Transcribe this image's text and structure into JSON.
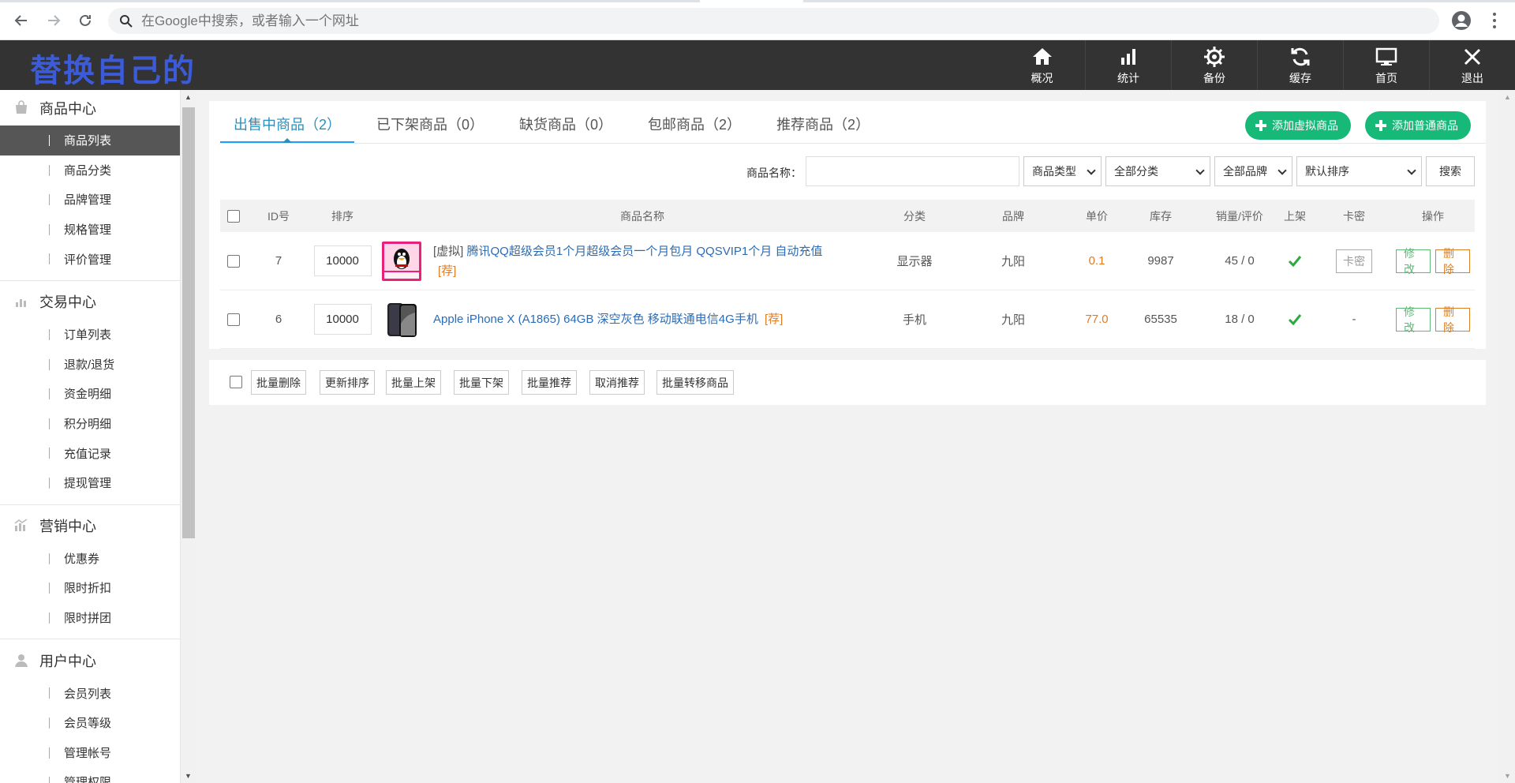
{
  "browser": {
    "omnibox_placeholder": "在Google中搜索，或者输入一个网址"
  },
  "header": {
    "logo_text": "替换自己的",
    "nav": [
      {
        "label": "概况",
        "icon": "home-icon"
      },
      {
        "label": "统计",
        "icon": "bar-chart-icon"
      },
      {
        "label": "备份",
        "icon": "gear-icon"
      },
      {
        "label": "缓存",
        "icon": "refresh-icon"
      },
      {
        "label": "首页",
        "icon": "monitor-icon"
      },
      {
        "label": "退出",
        "icon": "close-icon"
      }
    ]
  },
  "sidebar": {
    "groups": [
      {
        "title": "商品中心",
        "icon": "shop-icon",
        "items": [
          "商品列表",
          "商品分类",
          "品牌管理",
          "规格管理",
          "评价管理"
        ]
      },
      {
        "title": "交易中心",
        "icon": "bar-chart-icon",
        "items": [
          "订单列表",
          "退款/退货",
          "资金明细",
          "积分明细",
          "充值记录",
          "提现管理"
        ]
      },
      {
        "title": "营销中心",
        "icon": "marketing-icon",
        "items": [
          "优惠券",
          "限时折扣",
          "限时拼团"
        ]
      },
      {
        "title": "用户中心",
        "icon": "user-icon",
        "items": [
          "会员列表",
          "会员等级",
          "管理帐号",
          "管理权限"
        ]
      }
    ],
    "active_item": "商品列表"
  },
  "tabs": [
    {
      "label": "出售中商品（2）",
      "active": true
    },
    {
      "label": "已下架商品（0）",
      "active": false
    },
    {
      "label": "缺货商品（0）",
      "active": false
    },
    {
      "label": "包邮商品（2）",
      "active": false
    },
    {
      "label": "推荐商品（2）",
      "active": false
    }
  ],
  "actions": {
    "add_virtual": "添加虚拟商品",
    "add_normal": "添加普通商品"
  },
  "filter": {
    "name_label": "商品名称：",
    "name_value": "",
    "type_select": "商品类型",
    "category_select": "全部分类",
    "brand_select": "全部品牌",
    "sort_select": "默认排序",
    "search_button": "搜索"
  },
  "table": {
    "headers": [
      "ID号",
      "排序",
      "商品名称",
      "分类",
      "品牌",
      "单价",
      "库存",
      "销量/评价",
      "上架",
      "卡密",
      "操作"
    ],
    "rows": [
      {
        "id": "7",
        "sort": "10000",
        "name": "[虚拟] 腾讯QQ超级会员1个月超级会员一个月包月 QQSVIP1个月 自动充值",
        "name_prefix": "[虚拟]",
        "name_main": "腾讯QQ超级会员1个月超级会员一个月包月 QQSVIP1个月 自动充值",
        "tag": "[荐]",
        "category": "显示器",
        "brand": "九阳",
        "price": "0.1",
        "stock": "9987",
        "sales_reviews": "45 / 0",
        "on_shelf": true,
        "card_key": "卡密",
        "edit": "修改",
        "delete": "删除",
        "image": "qq-penguin-icon"
      },
      {
        "id": "6",
        "sort": "10000",
        "name_prefix": "",
        "name_main": "Apple iPhone X (A1865) 64GB 深空灰色 移动联通电信4G手机",
        "tag": "[荐]",
        "category": "手机",
        "brand": "九阳",
        "price": "77.0",
        "stock": "65535",
        "sales_reviews": "18 / 0",
        "on_shelf": true,
        "card_key": "-",
        "edit": "修改",
        "delete": "删除",
        "image": "iphone-icon"
      }
    ]
  },
  "bulk_actions": [
    "批量删除",
    "更新排序",
    "批量上架",
    "批量下架",
    "批量推荐",
    "取消推荐",
    "批量转移商品"
  ]
}
